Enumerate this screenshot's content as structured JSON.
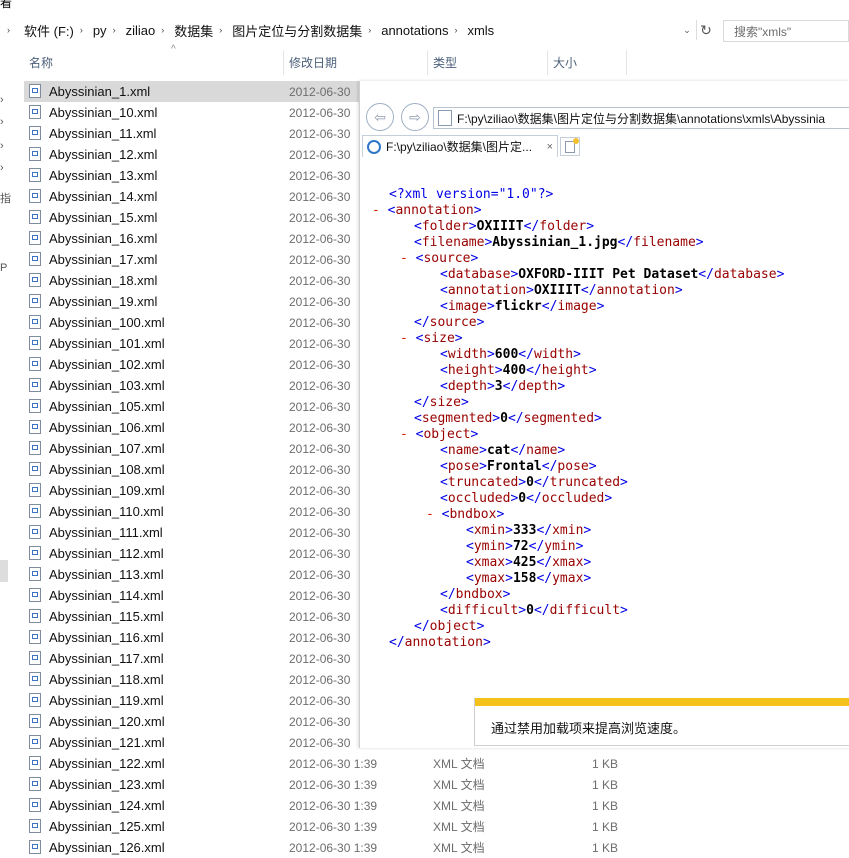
{
  "explorer": {
    "top_fragment": "看",
    "breadcrumbs": [
      "软件 (F:)",
      "py",
      "ziliao",
      "数据集",
      "图片定位与分割数据集",
      "annotations",
      "xmls"
    ],
    "search_placeholder": "搜索\"xmls\"",
    "columns": {
      "name": "名称",
      "date": "修改日期",
      "type": "类型",
      "size": "大小"
    },
    "nav_glyphs": [
      "指",
      "P"
    ],
    "files": [
      {
        "name": "Abyssinian_1.xml",
        "date": "2012-06-30",
        "type": "",
        "size": ""
      },
      {
        "name": "Abyssinian_10.xml",
        "date": "2012-06-30",
        "type": "",
        "size": ""
      },
      {
        "name": "Abyssinian_11.xml",
        "date": "2012-06-30",
        "type": "",
        "size": ""
      },
      {
        "name": "Abyssinian_12.xml",
        "date": "2012-06-30",
        "type": "",
        "size": ""
      },
      {
        "name": "Abyssinian_13.xml",
        "date": "2012-06-30",
        "type": "",
        "size": ""
      },
      {
        "name": "Abyssinian_14.xml",
        "date": "2012-06-30",
        "type": "",
        "size": ""
      },
      {
        "name": "Abyssinian_15.xml",
        "date": "2012-06-30",
        "type": "",
        "size": ""
      },
      {
        "name": "Abyssinian_16.xml",
        "date": "2012-06-30",
        "type": "",
        "size": ""
      },
      {
        "name": "Abyssinian_17.xml",
        "date": "2012-06-30",
        "type": "",
        "size": ""
      },
      {
        "name": "Abyssinian_18.xml",
        "date": "2012-06-30",
        "type": "",
        "size": ""
      },
      {
        "name": "Abyssinian_19.xml",
        "date": "2012-06-30",
        "type": "",
        "size": ""
      },
      {
        "name": "Abyssinian_100.xml",
        "date": "2012-06-30",
        "type": "",
        "size": ""
      },
      {
        "name": "Abyssinian_101.xml",
        "date": "2012-06-30",
        "type": "",
        "size": ""
      },
      {
        "name": "Abyssinian_102.xml",
        "date": "2012-06-30",
        "type": "",
        "size": ""
      },
      {
        "name": "Abyssinian_103.xml",
        "date": "2012-06-30",
        "type": "",
        "size": ""
      },
      {
        "name": "Abyssinian_105.xml",
        "date": "2012-06-30",
        "type": "",
        "size": ""
      },
      {
        "name": "Abyssinian_106.xml",
        "date": "2012-06-30",
        "type": "",
        "size": ""
      },
      {
        "name": "Abyssinian_107.xml",
        "date": "2012-06-30",
        "type": "",
        "size": ""
      },
      {
        "name": "Abyssinian_108.xml",
        "date": "2012-06-30",
        "type": "",
        "size": ""
      },
      {
        "name": "Abyssinian_109.xml",
        "date": "2012-06-30",
        "type": "",
        "size": ""
      },
      {
        "name": "Abyssinian_110.xml",
        "date": "2012-06-30",
        "type": "",
        "size": ""
      },
      {
        "name": "Abyssinian_111.xml",
        "date": "2012-06-30",
        "type": "",
        "size": ""
      },
      {
        "name": "Abyssinian_112.xml",
        "date": "2012-06-30",
        "type": "",
        "size": ""
      },
      {
        "name": "Abyssinian_113.xml",
        "date": "2012-06-30",
        "type": "",
        "size": ""
      },
      {
        "name": "Abyssinian_114.xml",
        "date": "2012-06-30",
        "type": "",
        "size": ""
      },
      {
        "name": "Abyssinian_115.xml",
        "date": "2012-06-30",
        "type": "",
        "size": ""
      },
      {
        "name": "Abyssinian_116.xml",
        "date": "2012-06-30",
        "type": "",
        "size": ""
      },
      {
        "name": "Abyssinian_117.xml",
        "date": "2012-06-30",
        "type": "",
        "size": ""
      },
      {
        "name": "Abyssinian_118.xml",
        "date": "2012-06-30",
        "type": "",
        "size": ""
      },
      {
        "name": "Abyssinian_119.xml",
        "date": "2012-06-30",
        "type": "",
        "size": ""
      },
      {
        "name": "Abyssinian_120.xml",
        "date": "2012-06-30",
        "type": "",
        "size": ""
      },
      {
        "name": "Abyssinian_121.xml",
        "date": "2012-06-30",
        "type": "",
        "size": ""
      },
      {
        "name": "Abyssinian_122.xml",
        "date": "2012-06-30 1:39",
        "type": "XML 文档",
        "size": "1 KB"
      },
      {
        "name": "Abyssinian_123.xml",
        "date": "2012-06-30 1:39",
        "type": "XML 文档",
        "size": "1 KB"
      },
      {
        "name": "Abyssinian_124.xml",
        "date": "2012-06-30 1:39",
        "type": "XML 文档",
        "size": "1 KB"
      },
      {
        "name": "Abyssinian_125.xml",
        "date": "2012-06-30 1:39",
        "type": "XML 文档",
        "size": "1 KB"
      },
      {
        "name": "Abyssinian_126.xml",
        "date": "2012-06-30 1:39",
        "type": "XML 文档",
        "size": "1 KB"
      }
    ]
  },
  "browser": {
    "address": "F:\\py\\ziliao\\数据集\\图片定位与分割数据集\\annotations\\xmls\\Abyssinia",
    "tab_title": "F:\\py\\ziliao\\数据集\\图片定...",
    "info_bar_text": "通过禁用加载项来提高浏览速度。",
    "xml": {
      "declaration": "<?xml version=\"1.0\"?>",
      "collapse_marker": "-",
      "folder": "OXIIIT",
      "filename": "Abyssinian_1.jpg",
      "database": "OXFORD-IIIT Pet Dataset",
      "annotation_src": "OXIIIT",
      "image": "flickr",
      "width": "600",
      "height": "400",
      "depth": "3",
      "segmented": "0",
      "name": "cat",
      "pose": "Frontal",
      "truncated": "0",
      "occluded": "0",
      "xmin": "333",
      "ymin": "72",
      "xmax": "425",
      "ymax": "158",
      "difficult": "0"
    }
  },
  "colors": {
    "xml_tag": "#990000",
    "xml_bracket": "#0000e6",
    "xml_minus": "#d02000",
    "info_bar": "#f5c21b",
    "selection": "#d9d9d9"
  }
}
